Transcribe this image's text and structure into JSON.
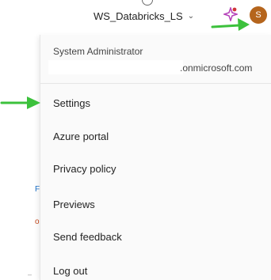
{
  "header": {
    "workspace_name": "WS_Databricks_LS",
    "workspace_chevron": "⌄",
    "avatar_initial": "S",
    "icons": {
      "partial": "circle-icon",
      "copilot": "sparkle-icon",
      "chevron": "chevron-down-icon"
    },
    "colors": {
      "avatar": "#b5651d",
      "sparkle": "#b542b9",
      "notification_dot": "#d13438"
    }
  },
  "account_menu": {
    "role": "System Administrator",
    "email_suffix": ".onmicrosoft.com",
    "items": [
      {
        "label": "Settings"
      },
      {
        "label": "Azure portal"
      },
      {
        "label": "Privacy policy"
      },
      {
        "label": "Previews"
      },
      {
        "label": "Send feedback"
      },
      {
        "label": "Log out"
      }
    ]
  },
  "background": {
    "fragment_f": "F",
    "fragment_o": "o",
    "fragment_dash": "–"
  },
  "annotations": {
    "arrow_color": "#3cc13c",
    "arrows": [
      "arrow-to-avatar",
      "arrow-to-settings"
    ]
  }
}
